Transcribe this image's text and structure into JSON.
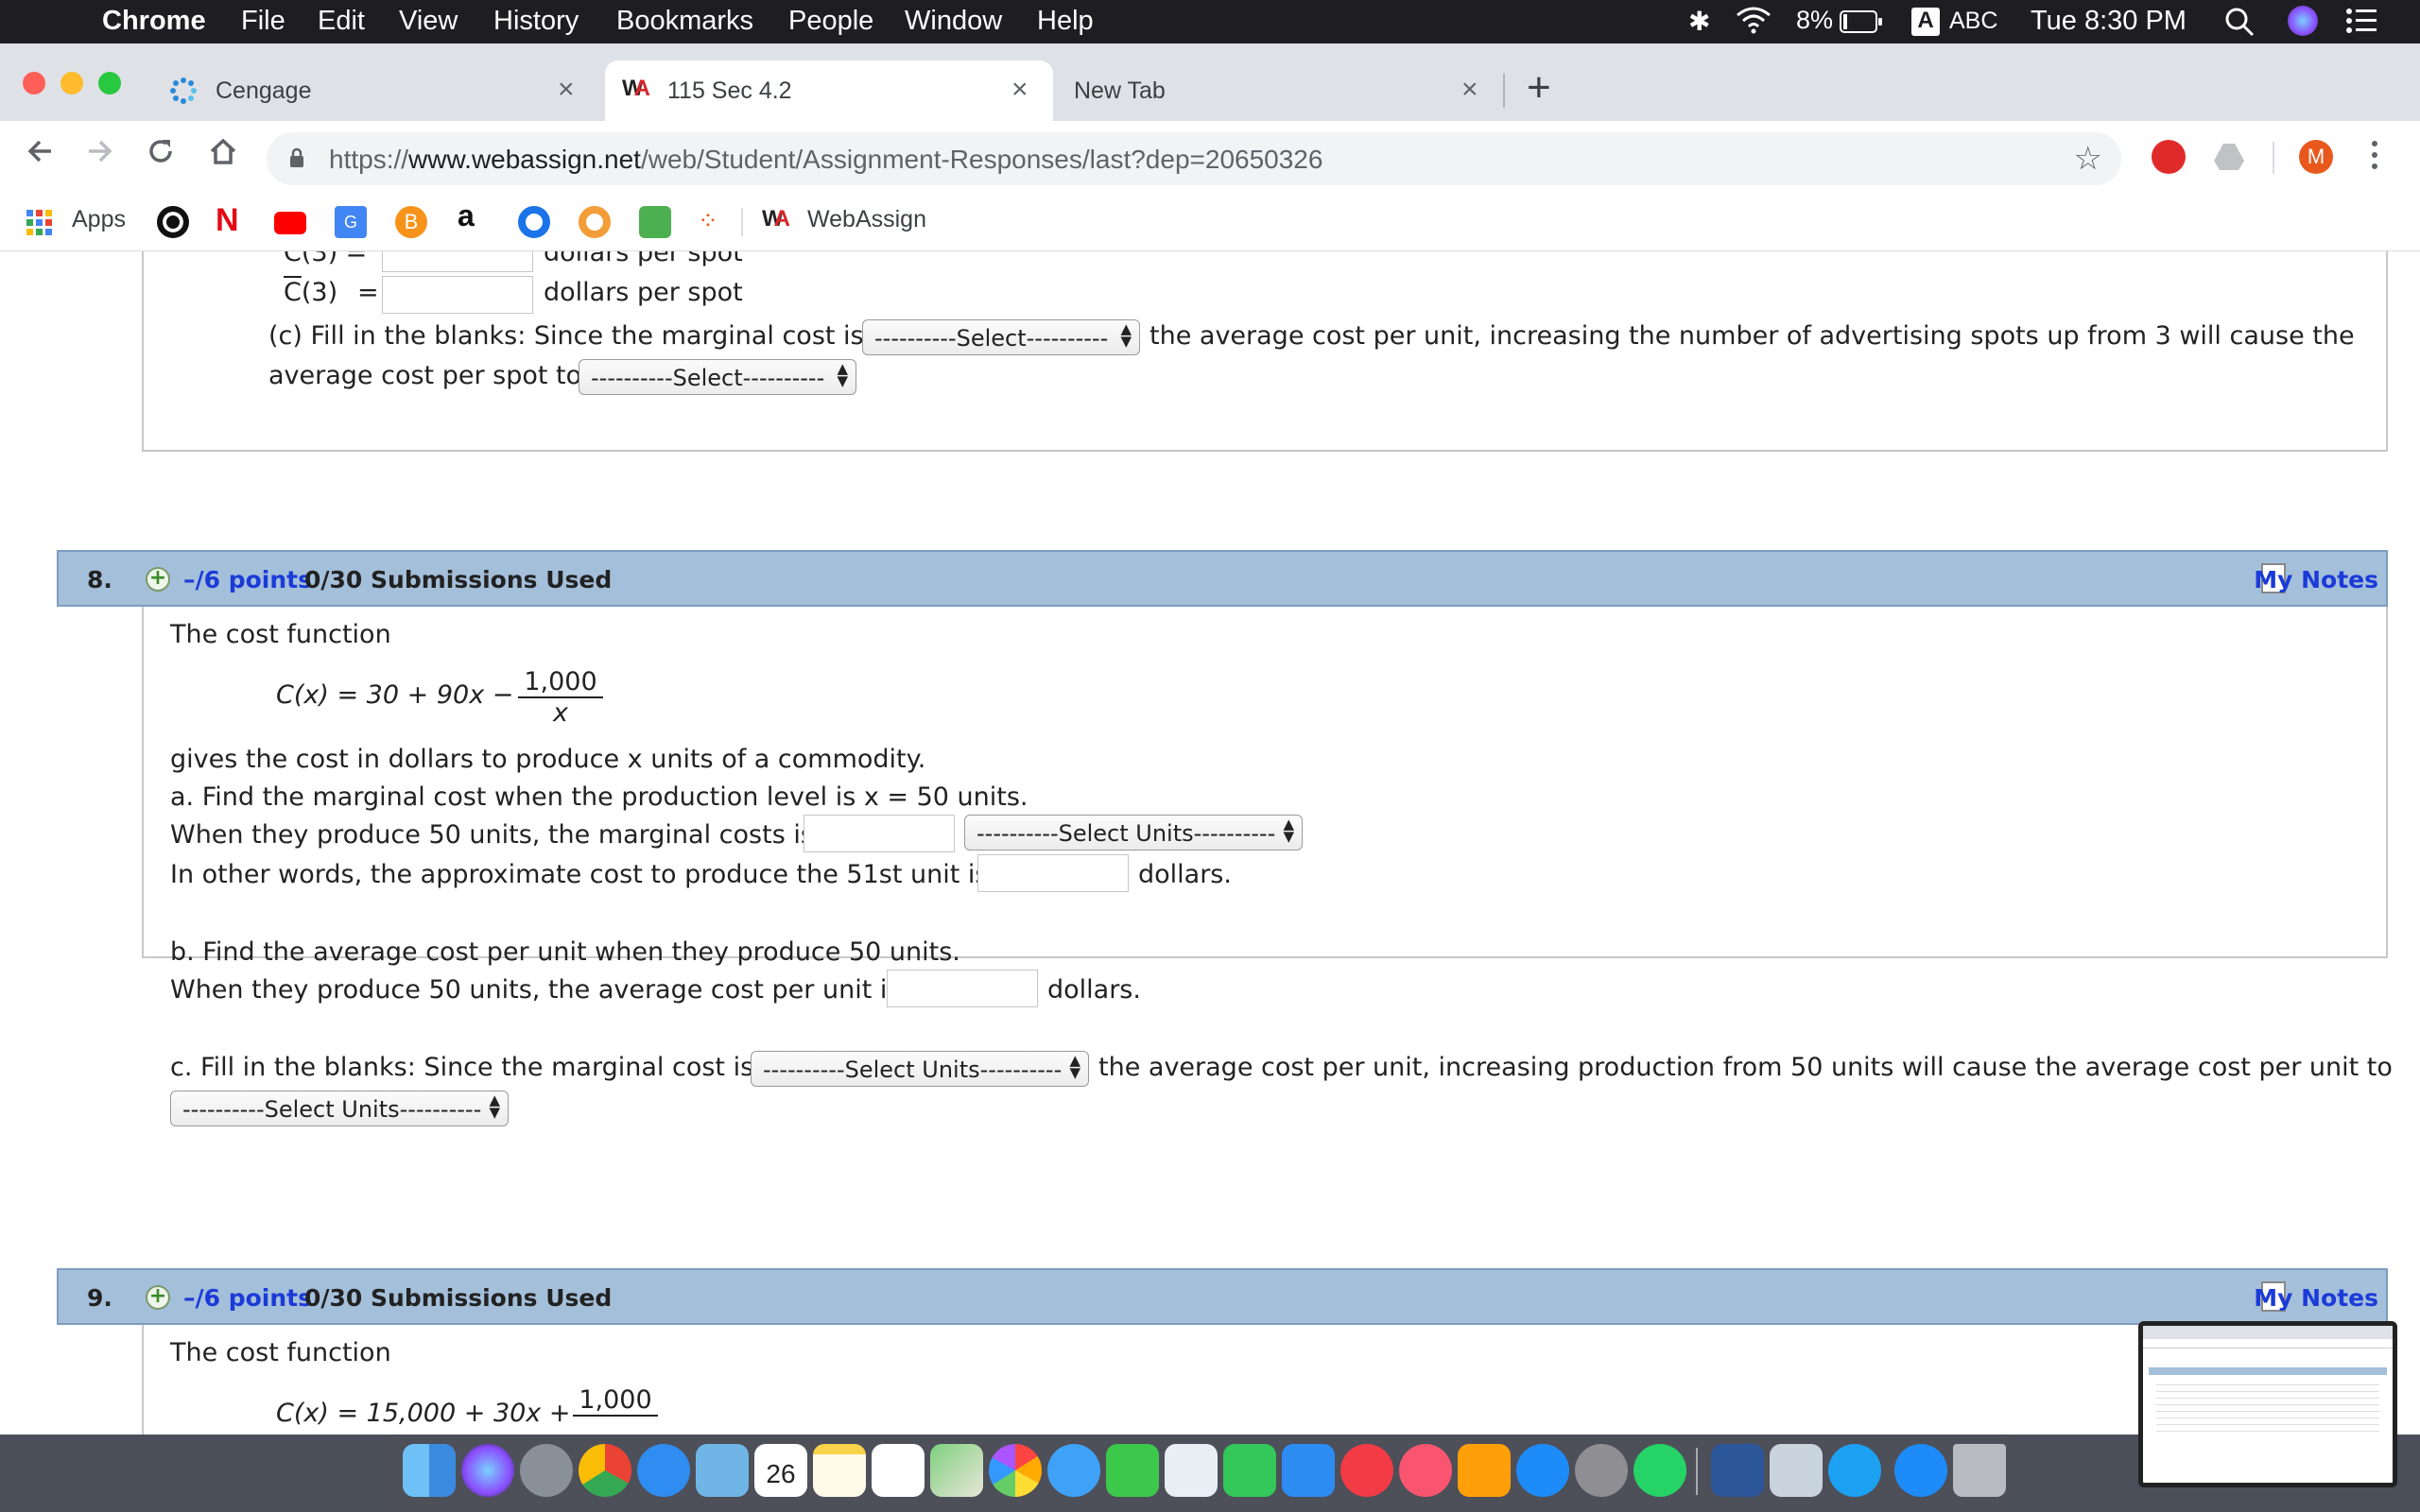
{
  "menubar": {
    "app": "Chrome",
    "items": [
      "File",
      "Edit",
      "View",
      "History",
      "Bookmarks",
      "People",
      "Window",
      "Help"
    ],
    "battery": "8%",
    "input_source": "ABC",
    "clock": "Tue 8:30 PM"
  },
  "tabs": [
    {
      "title": "Cengage"
    },
    {
      "title": "115 Sec 4.2"
    },
    {
      "title": "New Tab"
    }
  ],
  "toolbar": {
    "url_scheme": "https://",
    "url_host": "www.webassign.net",
    "url_path": "/web/Student/Assignment-Responses/last?dep=20650326",
    "profile_initial": "M"
  },
  "bookmarks": {
    "apps_label": "Apps",
    "webassign_label": "WebAssign"
  },
  "prev_question": {
    "c3_label_partial": "C(3) =",
    "c3_unit": "dollars per spot",
    "cbar3_label": "C(3)",
    "cbar3_equals": "=",
    "cbar3_unit": "dollars per spot",
    "c_text_1": "(c) Fill in the blanks: Since the marginal cost is",
    "c_select_1": "----------Select----------",
    "c_text_2": "the average cost per unit, increasing the number of advertising spots up from 3 will cause the",
    "c_text_3": "average cost per spot to",
    "c_select_2": "----------Select----------"
  },
  "q8": {
    "number": "8.",
    "points": "–/6 points",
    "submissions": "0/30 Submissions Used",
    "notes": "My Notes",
    "intro": "The cost function",
    "formula_lhs": "C(x) = 30 + 90x −",
    "formula_num": "1,000",
    "formula_den": "x",
    "desc": "gives the cost in dollars to produce x units of a commodity.",
    "a_prompt": "a. Find the marginal cost when the production level is x = 50 units.",
    "a_line1": "When they produce 50 units, the marginal costs is",
    "a_select": "----------Select Units----------",
    "a_line2": "In other words, the approximate cost to produce the 51st unit is",
    "a_unit2": "dollars.",
    "b_prompt": "b. Find the average cost per unit when they produce 50 units.",
    "b_line": "When they produce 50 units, the average cost per unit is",
    "b_unit": "dollars.",
    "c_text_1": "c. Fill in the blanks: Since the marginal cost is",
    "c_select_1": "----------Select Units----------",
    "c_text_2": "the average cost per unit, increasing production from 50 units will cause the average cost per unit to",
    "c_select_2": "----------Select Units----------"
  },
  "q9": {
    "number": "9.",
    "points": "–/6 points",
    "submissions": "0/30 Submissions Used",
    "notes": "My Notes",
    "intro": "The cost function",
    "formula_lhs": "C(x) = 15,000 + 30x +",
    "formula_num": "1,000"
  },
  "dock": {
    "calendar_day": "26"
  }
}
